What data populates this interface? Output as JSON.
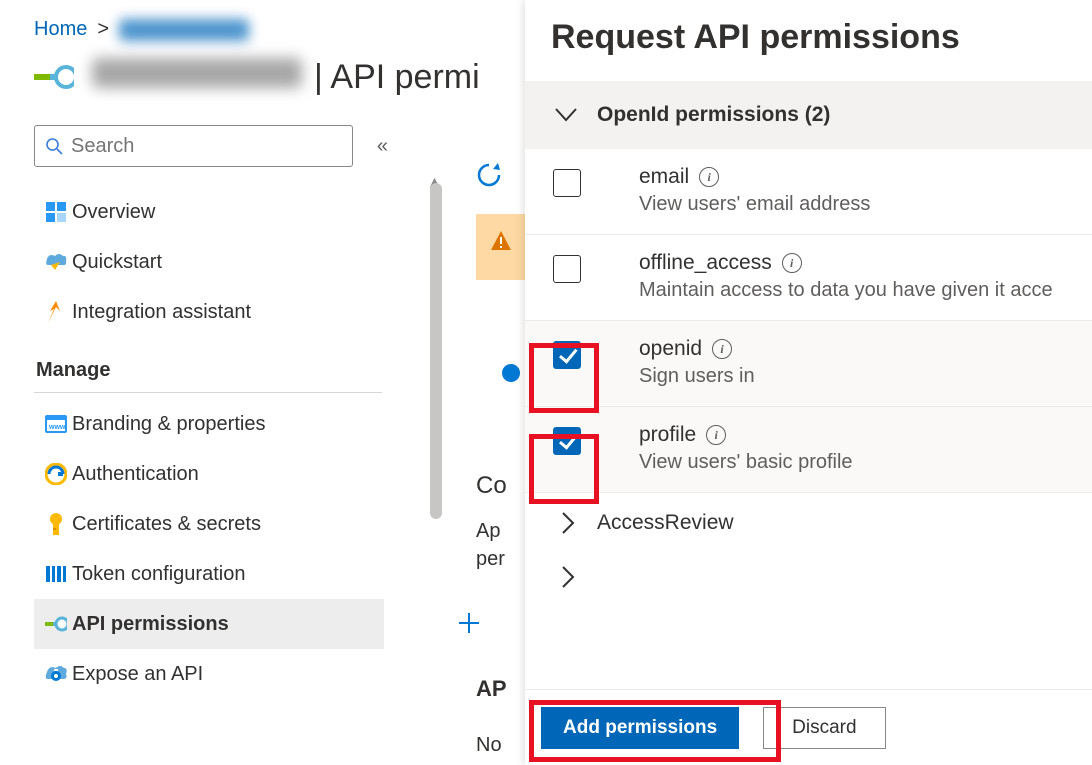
{
  "breadcrumb": {
    "home": "Home",
    "separator": ">"
  },
  "page": {
    "title_suffix": "| API permi"
  },
  "search": {
    "placeholder": "Search",
    "collapse_glyph": "«"
  },
  "nav": {
    "overview": "Overview",
    "quickstart": "Quickstart",
    "integration": "Integration assistant",
    "group_manage": "Manage",
    "branding": "Branding & properties",
    "authentication": "Authentication",
    "certificates": "Certificates & secrets",
    "token": "Token configuration",
    "api_permissions": "API permissions",
    "expose_api": "Expose an API"
  },
  "mid": {
    "con": "Co",
    "app": "Ap",
    "perr": "per",
    "api": "AP",
    "no": "No"
  },
  "panel": {
    "title": "Request API permissions",
    "group_header": "OpenId permissions (2)",
    "permissions": [
      {
        "name": "email",
        "desc": "View users' email address",
        "checked": false
      },
      {
        "name": "offline_access",
        "desc": "Maintain access to data you have given it acce",
        "checked": false
      },
      {
        "name": "openid",
        "desc": "Sign users in",
        "checked": true
      },
      {
        "name": "profile",
        "desc": "View users' basic profile",
        "checked": true
      }
    ],
    "collapsed0": "AccessReview",
    "add_btn": "Add permissions",
    "discard_btn": "Discard"
  }
}
